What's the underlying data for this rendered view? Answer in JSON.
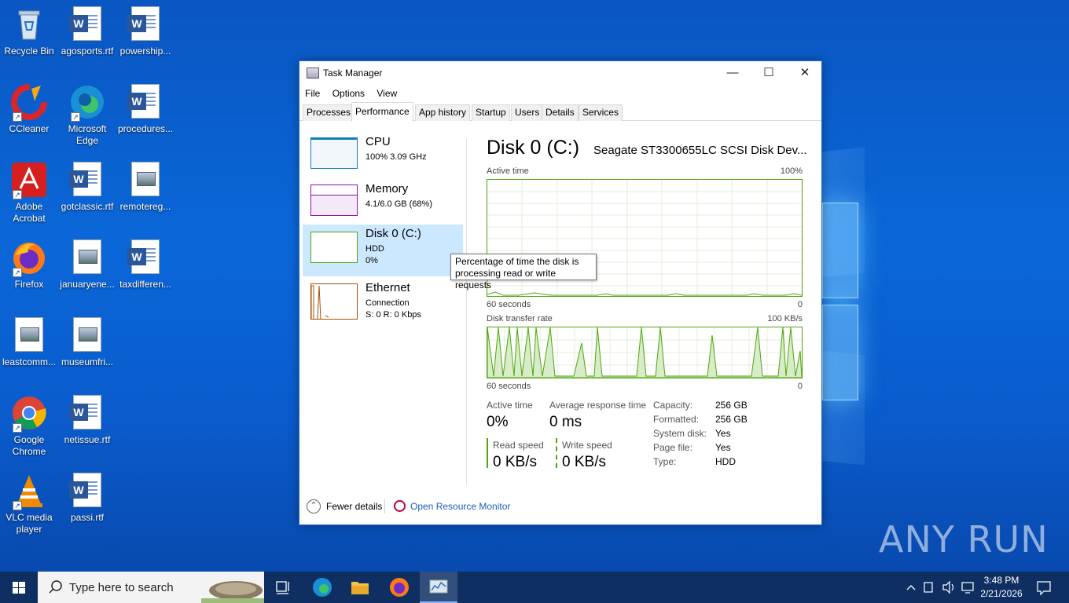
{
  "desktop": {
    "icons": [
      {
        "label": "Recycle Bin"
      },
      {
        "label": "agosports.rtf"
      },
      {
        "label": "powership..."
      },
      {
        "label": "CCleaner"
      },
      {
        "label": "Microsoft Edge"
      },
      {
        "label": "procedures..."
      },
      {
        "label": "Adobe Acrobat"
      },
      {
        "label": "gotclassic.rtf"
      },
      {
        "label": "remotereg..."
      },
      {
        "label": "Firefox"
      },
      {
        "label": "januaryene..."
      },
      {
        "label": "taxdifferen..."
      },
      {
        "label": "leastcomm..."
      },
      {
        "label": "museumfri..."
      },
      {
        "label": "Google Chrome"
      },
      {
        "label": "netissue.rtf"
      },
      {
        "label": "VLC media player"
      },
      {
        "label": "passi.rtf"
      }
    ],
    "watermark": "ANY RUN"
  },
  "window": {
    "title": "Task Manager",
    "menu": [
      "File",
      "Options",
      "View"
    ],
    "tabs": [
      "Processes",
      "Performance",
      "App history",
      "Startup",
      "Users",
      "Details",
      "Services"
    ],
    "active_tab": "Performance"
  },
  "sidebar": {
    "items": [
      {
        "name": "CPU",
        "line2": "100%  3.09 GHz",
        "line3": "",
        "color": "#117dbb"
      },
      {
        "name": "Memory",
        "line2": "4.1/6.0 GB (68%)",
        "line3": "",
        "color": "#8b12ae"
      },
      {
        "name": "Disk 0 (C:)",
        "line2": "HDD",
        "line3": "0%",
        "color": "#4da60c"
      },
      {
        "name": "Ethernet",
        "line2": "Connection",
        "line3": "S: 0  R: 0 Kbps",
        "color": "#a74f01"
      }
    ]
  },
  "tooltip": {
    "line1": "Percentage of time the disk is",
    "line2": "processing read or write requests"
  },
  "detail": {
    "title": "Disk 0 (C:)",
    "model": "Seagate ST3300655LC SCSI Disk Dev...",
    "graph1": {
      "label": "Active time",
      "max": "100%",
      "time": "60 seconds",
      "min": "0"
    },
    "graph2": {
      "label": "Disk transfer rate",
      "max": "100 KB/s",
      "time": "60 seconds",
      "min": "0"
    },
    "stats": {
      "active_time_label": "Active time",
      "active_time_value": "0%",
      "avg_resp_label": "Average response time",
      "avg_resp_value": "0 ms",
      "read_label": "Read speed",
      "read_value": "0 KB/s",
      "write_label": "Write speed",
      "write_value": "0 KB/s"
    },
    "properties": [
      {
        "k": "Capacity:",
        "v": "256 GB"
      },
      {
        "k": "Formatted:",
        "v": "256 GB"
      },
      {
        "k": "System disk:",
        "v": "Yes"
      },
      {
        "k": "Page file:",
        "v": "Yes"
      },
      {
        "k": "Type:",
        "v": "HDD"
      }
    ]
  },
  "footer": {
    "fewer_details": "Fewer details",
    "resource_monitor": "Open Resource Monitor"
  },
  "taskbar": {
    "search_placeholder": "Type here to search",
    "time": "3:48 PM",
    "date": "2/21/2026"
  },
  "colors": {
    "accent": "#4da60c",
    "selection": "#cce8ff",
    "taskbar": "#0f2f63"
  }
}
